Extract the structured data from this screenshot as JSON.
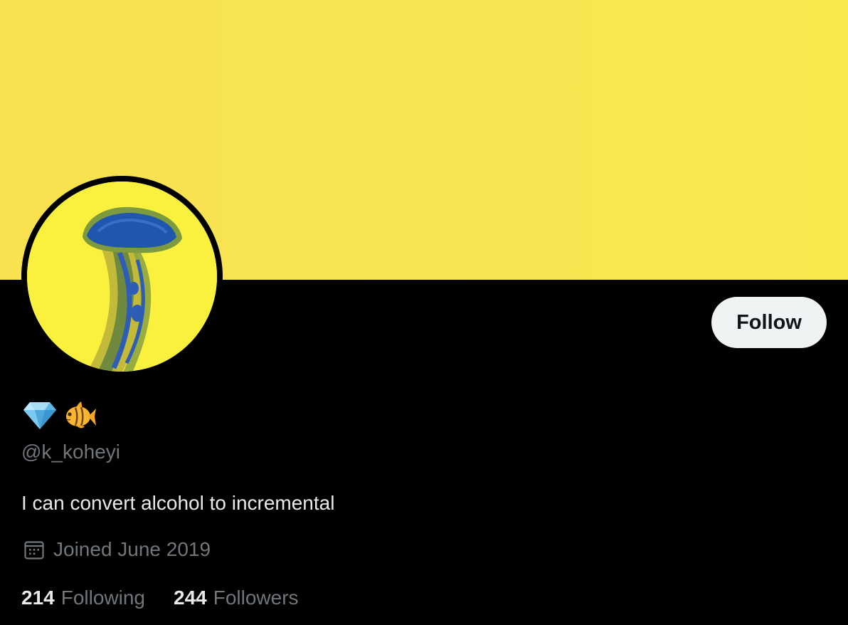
{
  "profile": {
    "name_emojis": [
      "diamond-emoji",
      "tropical-fish-emoji"
    ],
    "handle": "@k_koheyi",
    "bio": "I can convert alcohol to incremental",
    "joined": "Joined June 2019",
    "following_count": "214",
    "following_label": "Following",
    "followers_count": "244",
    "followers_label": "Followers"
  },
  "actions": {
    "follow_label": "Follow"
  },
  "colors": {
    "banner": "#f9e352",
    "background": "#000000",
    "avatar_bg": "#faf03e",
    "follow_button_bg": "#eff3f4",
    "primary_text": "#e7e9ea",
    "secondary_text": "#71767b"
  },
  "icons": {
    "avatar": "jellyfish-avatar",
    "joined": "calendar-icon"
  }
}
